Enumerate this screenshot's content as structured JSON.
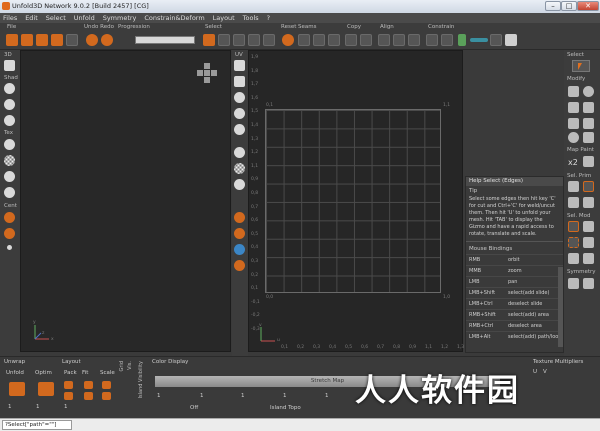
{
  "window": {
    "title": "Unfold3D Network 9.0.2 [Build 2457] [CG]",
    "min": "–",
    "max": "□",
    "close": "✕"
  },
  "menu": [
    "Files",
    "Edit",
    "Select",
    "Unfold",
    "Symmetry",
    "Constrain&Deform",
    "Layout",
    "Tools",
    "?"
  ],
  "toolbar": {
    "file": "File",
    "undoredo": "Undo Redo",
    "progression": "Progression",
    "select": "Select",
    "reset": "Reset",
    "seams": "Seams",
    "copy": "Copy",
    "align": "Align",
    "constrain": "Constrain",
    "progress_value": 0
  },
  "left_side": {
    "view3d": "3D",
    "shad": "Shad",
    "tex": "Tex",
    "cent": "Cent"
  },
  "uv_side": {
    "uv": "UV"
  },
  "viewport_uv": {
    "corner_tl": "0,1",
    "corner_tr": "1,1",
    "corner_bl": "0,0",
    "corner_br": "1,0",
    "y_ticks": [
      "1,9",
      "1,8",
      "1,7",
      "1,6",
      "1,5",
      "1,4",
      "1,3",
      "1,2",
      "1,1",
      "0,9",
      "0,8",
      "0,7",
      "0,6",
      "0,5",
      "0,4",
      "0,3",
      "0,2",
      "0,1",
      "-0,1",
      "-0,2",
      "-0,3"
    ],
    "x_ticks": [
      "0,1",
      "0,2",
      "0,3",
      "0,4",
      "0,5",
      "0,6",
      "0,7",
      "0,8",
      "0,9",
      "1,1",
      "1,2",
      "1,3"
    ]
  },
  "axes": {
    "x": "x",
    "y": "y",
    "z": "z",
    "u": "u",
    "v": "v"
  },
  "right_col": {
    "select": "Select",
    "modify": "Modify",
    "map_paint": "Map Paint",
    "x2": "x2",
    "sel_prim": "Sel. Prim",
    "sel_mod": "Sel. Mod",
    "symmetry": "Symmetry"
  },
  "help": {
    "title": "Help Select (Edges)",
    "tip_label": "Tip",
    "tip": "Select some edges then hit key 'C' for cut and Ctrl+'C' for weld/uncut them. Then hit 'U' to unfold your mesh. Hit 'TAB' to display the Gizmo and have a rapid access to rotate, translate and scale.",
    "mouse_bindings": "Mouse Bindings",
    "bindings": [
      {
        "k": "RMB",
        "v": "orbit"
      },
      {
        "k": "MMB",
        "v": "zoom"
      },
      {
        "k": "LMB",
        "v": "pan"
      },
      {
        "k": "LMB+Shift",
        "v": "select(add slide)"
      },
      {
        "k": "LMB+Ctrl",
        "v": "deselect slide"
      },
      {
        "k": "RMB+Shift",
        "v": "select(add) area"
      },
      {
        "k": "RMB+Ctrl",
        "v": "deselect area"
      },
      {
        "k": "LMB+Alt",
        "v": "select(add) path/loo"
      }
    ]
  },
  "bottom": {
    "unwrap": "Unwrap",
    "unfold": "Unfold",
    "optim": "Optim",
    "layout": "Layout",
    "pack": "Pack",
    "fit": "Fit",
    "scale": "Scale",
    "grid": "Grid",
    "vis": "Vis.",
    "island_visibility": "Island Visibility",
    "color_display": "Color Display",
    "stretch_map": "Stretch Map",
    "off": "Off",
    "island_topo": "Island Topo",
    "texture_multipliers": "Texture Multipliers",
    "unfold_val": "1",
    "optim_val": "1",
    "pack_val": "1",
    "cd_vals": [
      "1",
      "1",
      "1",
      "1",
      "1"
    ],
    "u": "U",
    "v": "V"
  },
  "status": {
    "field": "?Select[\"path\"=\"\"]"
  },
  "watermark": "人人软件园",
  "colors": {
    "accent": "#d2691e",
    "bg": "#3a3a3a",
    "viewport": "#282828"
  }
}
